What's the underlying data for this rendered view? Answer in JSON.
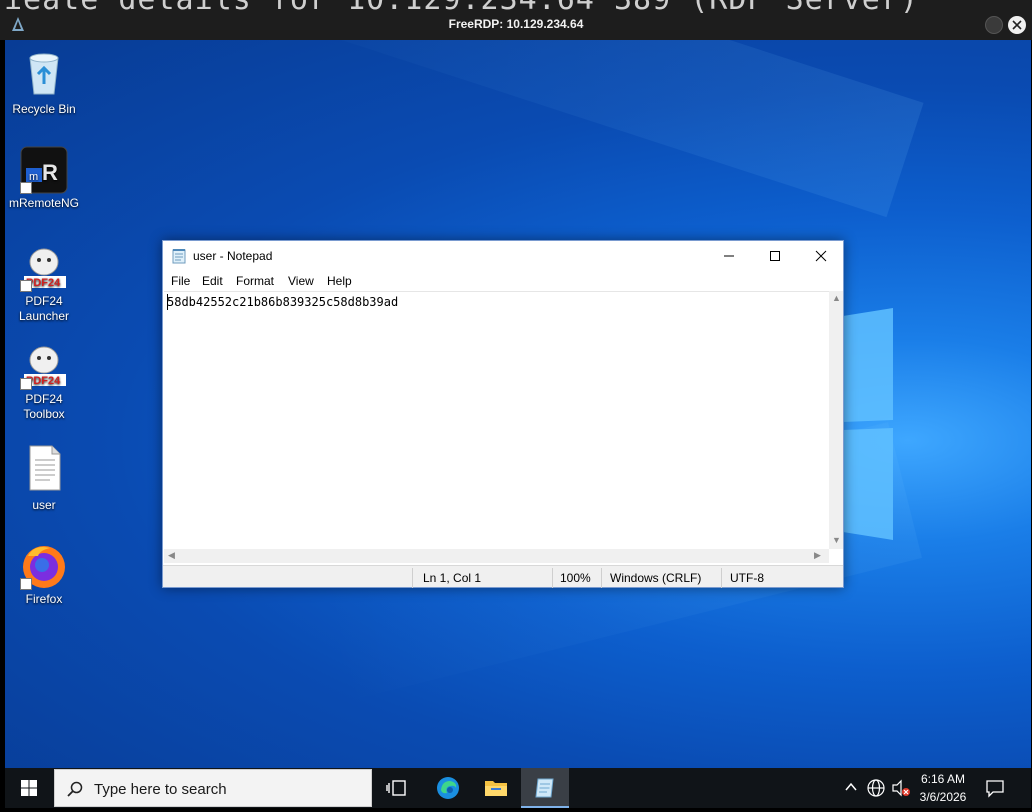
{
  "rdp_window": {
    "background_terminal_text": "ieate details for 10.129.234.64 389 (RDP Server)",
    "title": "FreeRDP: 10.129.234.64"
  },
  "desktop_icons": [
    {
      "label": "Recycle Bin",
      "icon": "recycle-bin-icon"
    },
    {
      "label": "mRemoteNG",
      "icon": "mremoteng-icon"
    },
    {
      "label": "PDF24 Launcher",
      "icon": "pdf24-icon"
    },
    {
      "label": "PDF24 Toolbox",
      "icon": "pdf24-icon"
    },
    {
      "label": "user",
      "icon": "text-file-icon"
    },
    {
      "label": "Firefox",
      "icon": "firefox-icon"
    }
  ],
  "notepad": {
    "title": "user - Notepad",
    "menu": [
      "File",
      "Edit",
      "Format",
      "View",
      "Help"
    ],
    "content": "58db42552c21b86b839325c58d8b39ad",
    "status": {
      "position": "Ln 1, Col 1",
      "zoom": "100%",
      "line_endings": "Windows (CRLF)",
      "encoding": "UTF-8"
    }
  },
  "taskbar": {
    "search_placeholder": "Type here to search",
    "apps": [
      "task-view-icon",
      "edge-icon",
      "file-explorer-icon",
      "notepad-icon"
    ],
    "active_app": "notepad-icon",
    "clock_time": "6:16 AM",
    "clock_date": "3/6/2026"
  },
  "colors": {
    "desktop_blue": "#0a4bb2",
    "taskbar": "#101418",
    "accent": "#7fb2ea"
  }
}
